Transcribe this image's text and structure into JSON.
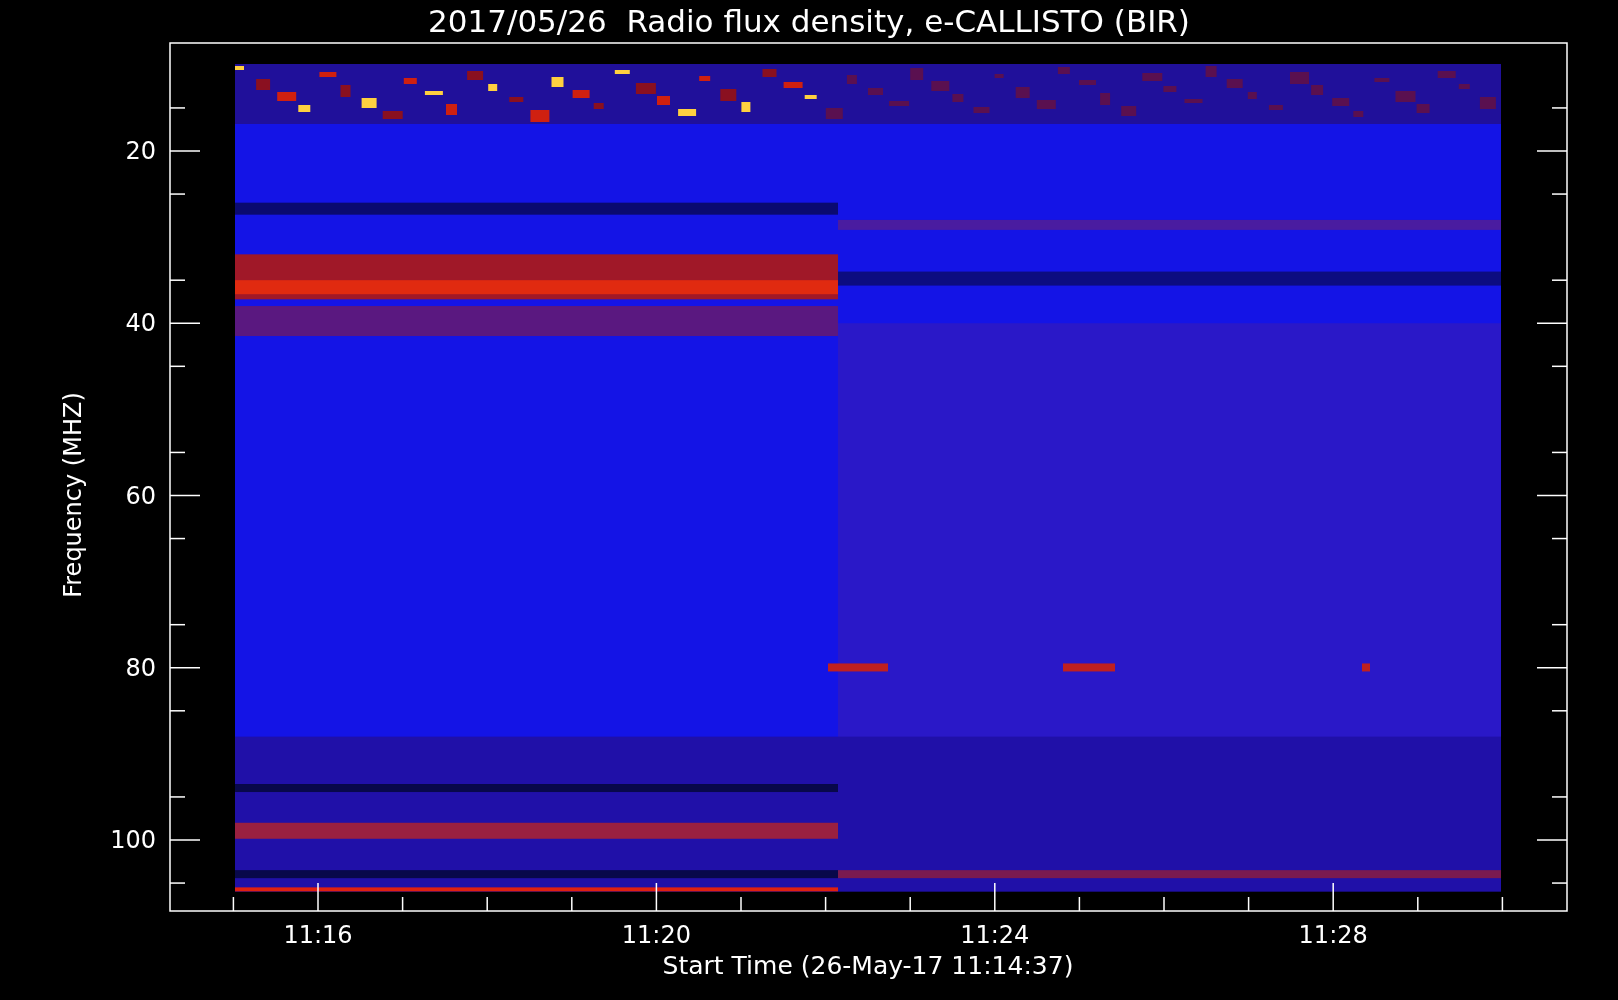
{
  "title": "2017/05/26  Radio flux density, e-CALLISTO (BIR)",
  "plot": {
    "y_axis": {
      "label": "Frequency (MHZ)",
      "ticks": [
        "20",
        "40",
        "60",
        "80",
        "100"
      ]
    },
    "x_axis": {
      "label": "Start Time (26-May-17 11:14:37)",
      "ticks": [
        "11:16",
        "11:20",
        "11:24",
        "11:28"
      ]
    }
  }
}
